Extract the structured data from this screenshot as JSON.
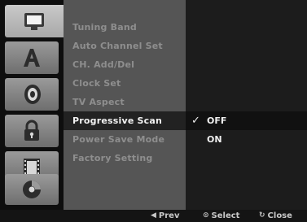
{
  "tabs": [
    {
      "icon": "monitor-icon",
      "active": true
    },
    {
      "icon": "language-a-icon",
      "active": false
    },
    {
      "icon": "speaker-icon",
      "active": false
    },
    {
      "icon": "lock-icon",
      "active": false
    },
    {
      "icon": "film-icon",
      "active": false
    },
    {
      "icon": "disc-icon",
      "active": false
    }
  ],
  "menu": {
    "items": [
      {
        "label": "Tuning Band"
      },
      {
        "label": "Auto Channel Set"
      },
      {
        "label": "CH. Add/Del"
      },
      {
        "label": "Clock Set"
      },
      {
        "label": "TV Aspect"
      },
      {
        "label": "Progressive Scan"
      },
      {
        "label": "Power Save Mode"
      },
      {
        "label": "Factory Setting"
      }
    ]
  },
  "options": {
    "items": [
      {
        "label": "OFF",
        "checked": true
      },
      {
        "label": "ON",
        "checked": false
      }
    ]
  },
  "bottom": {
    "prev_label": "Prev",
    "select_label": "Select",
    "close_label": "Close"
  },
  "colors": {
    "menu_bg": "#555555",
    "highlight_bg": "#222222",
    "tab_active": "#bbbbbb",
    "tab_inactive": "#858585"
  }
}
